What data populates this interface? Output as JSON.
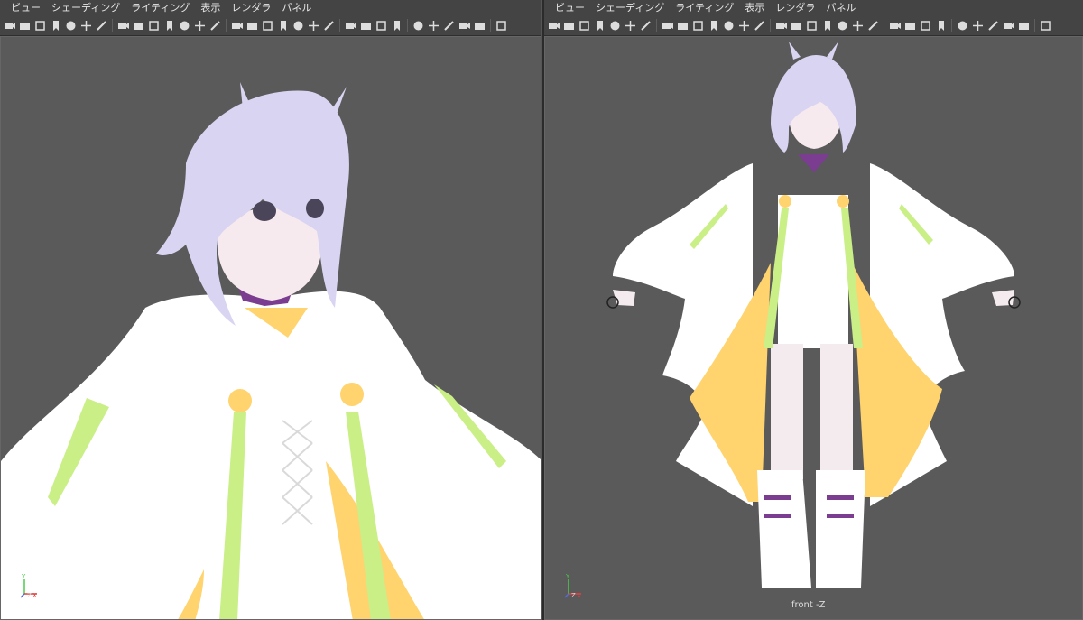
{
  "menus": [
    "ビュー",
    "シェーディング",
    "ライティング",
    "表示",
    "レンダラ",
    "パネル"
  ],
  "left_viewport": {
    "axis": {
      "y": "Y",
      "z": "Z",
      "x": "X"
    }
  },
  "right_viewport": {
    "axis": {
      "y": "Y",
      "z": "Z",
      "x": "X"
    },
    "camera_label": "front -Z"
  },
  "colors": {
    "hair": "#d8d4f2",
    "coat": "#ffffff",
    "lining": "#ffd36e",
    "ribbon": "#c9ef86",
    "collar": "#7a3d8f",
    "background": "#5a5a5a"
  },
  "toolbar_icons": [
    "camera-icon",
    "camera-lock-icon",
    "camera-attr-icon",
    "bookmark-icon",
    "image-plane-icon",
    "2d-pan-icon",
    "grease-pencil-icon",
    "grid-icon",
    "film-gate-icon",
    "resolution-gate-icon",
    "gate-mask-icon",
    "field-chart-icon",
    "safe-action-icon",
    "safe-title-icon",
    "wireframe-icon",
    "smooth-shade-icon",
    "default-material-icon",
    "shaded-wireframe-icon",
    "textured-icon",
    "lights-icon",
    "shadows-icon",
    "ssao-icon",
    "motion-blur-icon",
    "anti-alias-icon",
    "depth-of-field-icon",
    "isolate-icon",
    "xray-icon",
    "xray-active-icon",
    "xray-joints-icon",
    "backface-icon",
    "resolution-icon"
  ]
}
